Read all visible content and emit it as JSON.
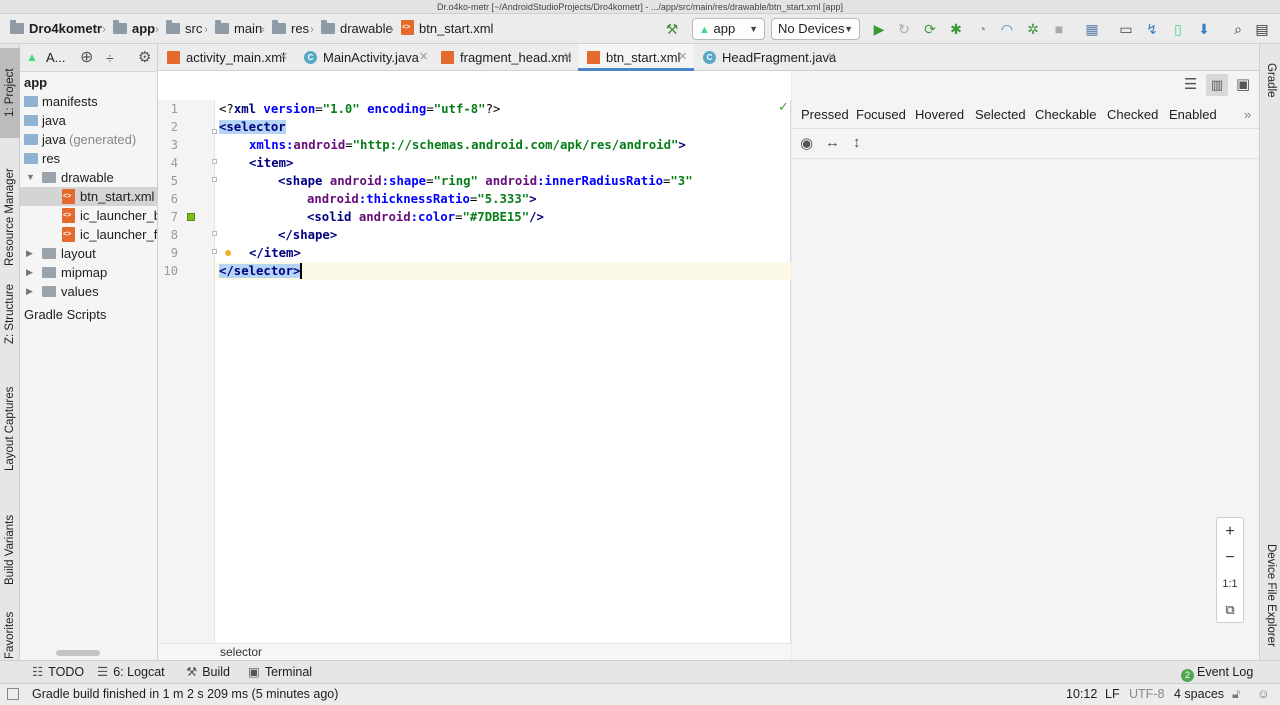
{
  "window": {
    "title": "Dr.o4ko-metr [~/AndroidStudioProjects/Dro4kometr] - .../app/src/main/res/drawable/btn_start.xml [app]"
  },
  "breadcrumbs": [
    "Dro4kometr",
    "app",
    "src",
    "main",
    "res",
    "drawable",
    "btn_start.xml"
  ],
  "run_config": {
    "module": "app",
    "device": "No Devices"
  },
  "left_tool_tabs": [
    "1: Project",
    "Resource Manager",
    "Z: Structure",
    "Layout Captures",
    "Build Variants",
    "Favorites"
  ],
  "right_tool_tabs": [
    "Gradle",
    "Device File Explorer"
  ],
  "project": {
    "view_label": "A...",
    "tree": [
      {
        "label": "app",
        "kind": "root"
      },
      {
        "label": "manifests",
        "kind": "folder"
      },
      {
        "label": "java",
        "kind": "folder"
      },
      {
        "label": "java",
        "suffix": "(generated)",
        "kind": "folder"
      },
      {
        "label": "res",
        "kind": "folder"
      },
      {
        "label": "drawable",
        "kind": "folder"
      },
      {
        "label": "btn_start.xml",
        "kind": "xml"
      },
      {
        "label": "ic_launcher_b",
        "kind": "xml"
      },
      {
        "label": "ic_launcher_fo",
        "kind": "xml"
      },
      {
        "label": "layout",
        "kind": "folder"
      },
      {
        "label": "mipmap",
        "kind": "folder"
      },
      {
        "label": "values",
        "kind": "folder"
      },
      {
        "label": "Gradle Scripts",
        "kind": "gradle"
      }
    ]
  },
  "tabs": [
    {
      "label": "activity_main.xml",
      "type": "xml"
    },
    {
      "label": "MainActivity.java",
      "type": "class"
    },
    {
      "label": "fragment_head.xml",
      "type": "xml"
    },
    {
      "label": "btn_start.xml",
      "type": "xml",
      "active": true
    },
    {
      "label": "HeadFragment.java",
      "type": "class"
    }
  ],
  "editor": {
    "line_numbers": [
      "1",
      "2",
      "3",
      "4",
      "5",
      "6",
      "7",
      "8",
      "9",
      "10"
    ],
    "lines": {
      "l1": {
        "a": "<?",
        "b": "xml",
        "c": " version",
        "d": "=",
        "e": "\"1.0\"",
        "f": " encoding",
        "g": "=",
        "h": "\"utf-8\"",
        "i": "?>"
      },
      "l2": {
        "a": "<selector"
      },
      "l3": {
        "a": "xmlns:",
        "b": "android",
        "c": "=",
        "d": "\"http://schemas.android.com/apk/res/android\"",
        "e": ">"
      },
      "l4": {
        "a": "<item",
        "b": ">"
      },
      "l5": {
        "a": "<shape",
        "b": " android",
        "c": ":shape",
        "d": "=",
        "e": "\"ring\"",
        "f": " android",
        "g": ":innerRadiusRatio",
        "h": "=",
        "i": "\"3\""
      },
      "l6": {
        "a": "android",
        "b": ":thicknessRatio",
        "c": "=",
        "d": "\"5.333\"",
        "e": ">"
      },
      "l7": {
        "a": "<solid",
        "b": " android",
        "c": ":color",
        "d": "=",
        "e": "\"#7DBE15\"",
        "f": "/>"
      },
      "l8": {
        "a": "</shape",
        "b": ">"
      },
      "l9": {
        "a": "</item",
        "b": ">"
      },
      "l10": {
        "a": "</selector>"
      }
    },
    "breadcrumb": "selector",
    "color_swatch": "#7DBE15"
  },
  "preview": {
    "states": [
      "Pressed",
      "Focused",
      "Hovered",
      "Selected",
      "Checkable",
      "Checked",
      "Enabled"
    ],
    "more": "»",
    "zoom": {
      "in": "+",
      "out": "−",
      "actual": "1:1"
    }
  },
  "bottom_tabs": [
    {
      "label": "TODO"
    },
    {
      "label": "6: Logcat"
    },
    {
      "label": "Build"
    },
    {
      "label": "Terminal"
    }
  ],
  "event_log": {
    "count": "2",
    "label": "Event Log"
  },
  "status": {
    "message": "Gradle build finished in 1 m 2 s 209 ms (5 minutes ago)",
    "position": "10:12",
    "line_sep": "LF",
    "encoding": "UTF-8",
    "indent": "4 spaces"
  }
}
